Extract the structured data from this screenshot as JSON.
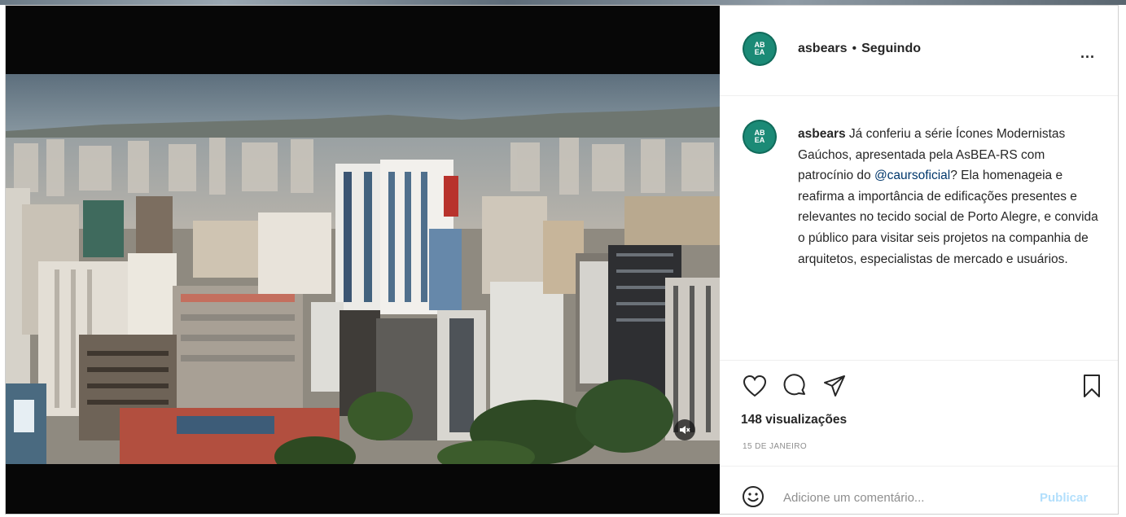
{
  "post": {
    "username": "asbears",
    "separator": "•",
    "follow_status": "Seguindo",
    "more_label": "...",
    "avatar_text": "ABEA",
    "caption": {
      "username": "asbears",
      "text_before": " Já conferiu a série Ícones Modernistas Gaúchos, apresentada pela AsBEA-RS com patrocínio do ",
      "mention": "@caursoficial",
      "text_after": "? Ela homenageia e reafirma a importância de edificações presentes e relevantes no tecido social de Porto Alegre, e convida o público para visitar seis projetos na companhia de arquitetos, especialistas de mercado e usuários."
    },
    "views": "148 visualizações",
    "date": "15 de janeiro",
    "comment_placeholder": "Adicione um comentário...",
    "publish_label": "Publicar"
  },
  "icons": {
    "like": "heart-icon",
    "comment": "comment-icon",
    "share": "send-icon",
    "save": "bookmark-icon",
    "emoji": "emoji-icon",
    "mute": "muted-speaker-icon",
    "more": "more-options-icon"
  },
  "colors": {
    "brand_avatar": "#1b8a76",
    "mention": "#00376b",
    "publish_disabled": "#b2dffc",
    "muted_text": "#8e8e8e",
    "media_bg": "#070707"
  }
}
